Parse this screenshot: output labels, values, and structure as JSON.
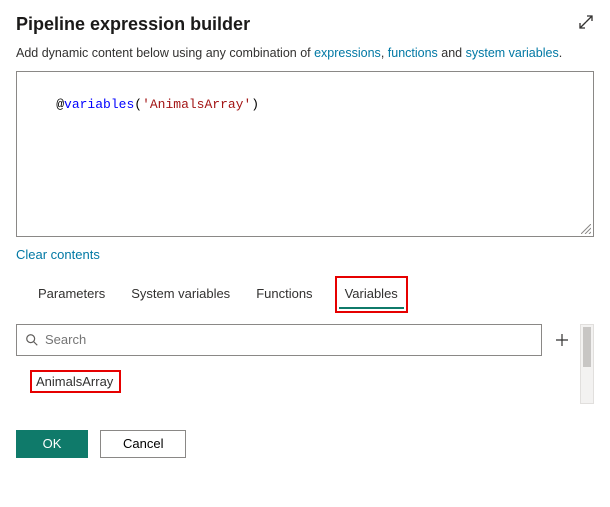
{
  "header": {
    "title": "Pipeline expression builder"
  },
  "description": {
    "prefix": "Add dynamic content below using any combination of ",
    "link_expressions": "expressions",
    "sep1": ", ",
    "link_functions": "functions",
    "sep2": " and ",
    "link_sysvars": "system variables",
    "suffix": "."
  },
  "editor": {
    "at": "@",
    "fn": "variables",
    "open": "(",
    "str": "'AnimalsArray'",
    "close": ")"
  },
  "actions": {
    "clear": "Clear contents"
  },
  "tabs": {
    "parameters": "Parameters",
    "system_variables": "System variables",
    "functions": "Functions",
    "variables": "Variables"
  },
  "search": {
    "placeholder": "Search"
  },
  "variables_list": {
    "item0": "AnimalsArray"
  },
  "footer": {
    "ok": "OK",
    "cancel": "Cancel"
  }
}
